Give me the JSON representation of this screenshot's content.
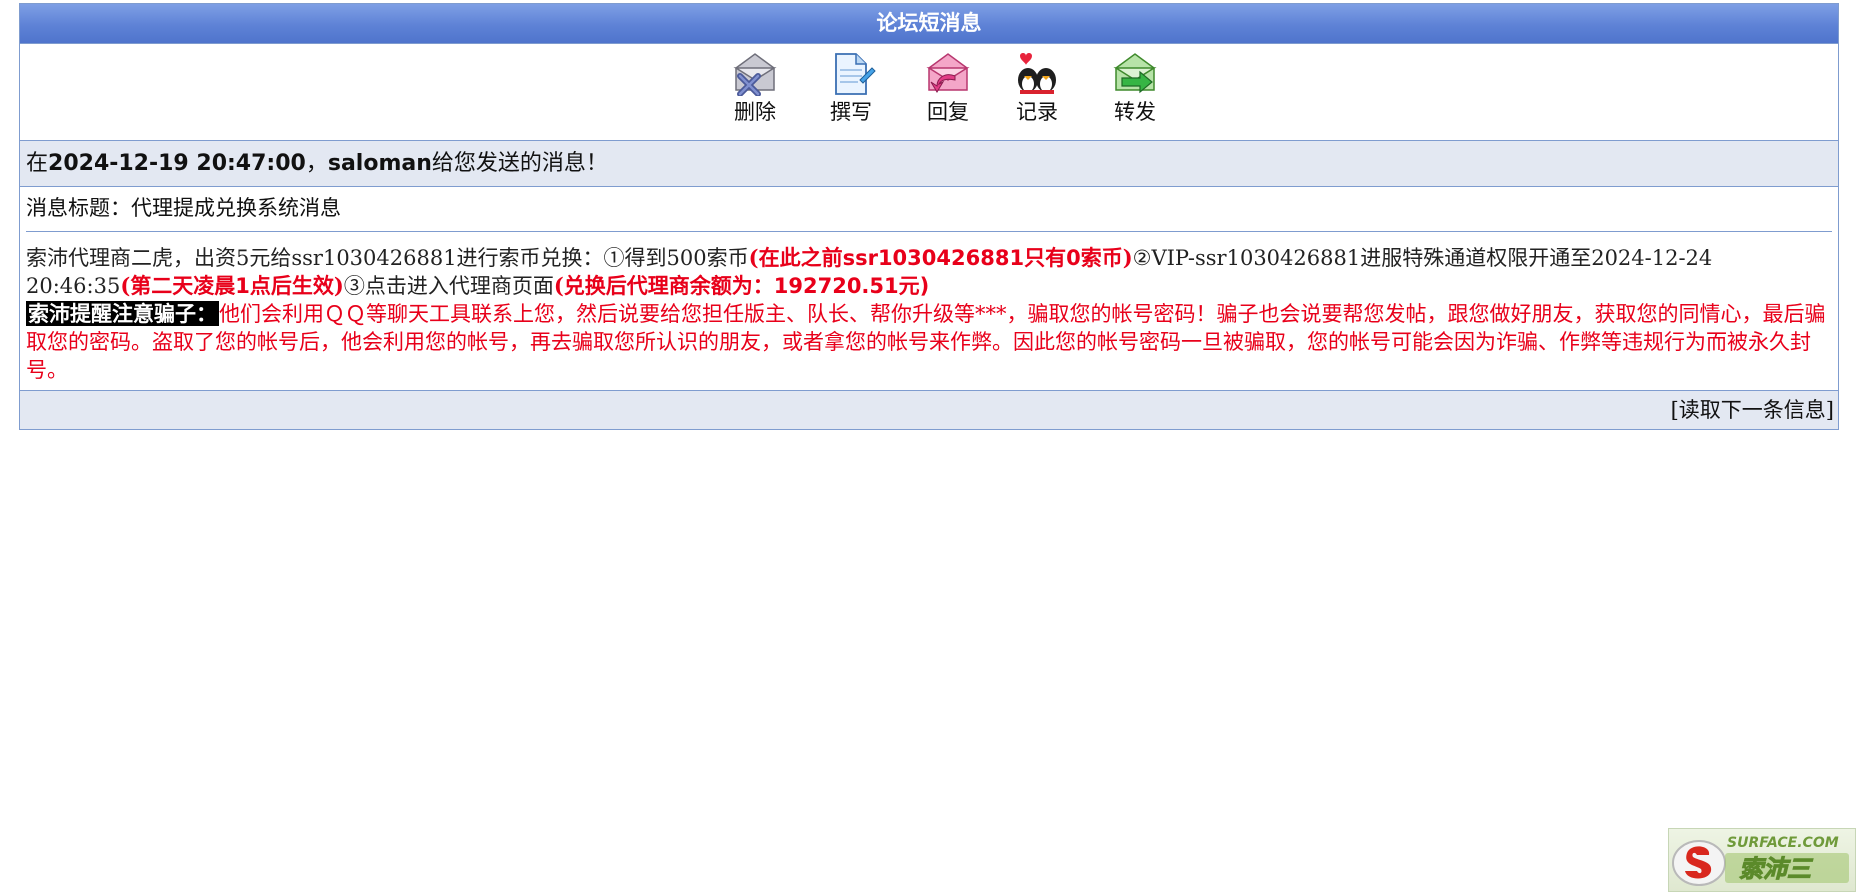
{
  "title": "论坛短消息",
  "toolbar": {
    "delete_label": "删除",
    "compose_label": "撰写",
    "reply_label": "回复",
    "record_label": "记录",
    "forward_label": "转发"
  },
  "sender": {
    "prefix": "在",
    "datetime": "2024-12-19 20:47:00",
    "separator": "，",
    "name": "saloman",
    "suffix": "给您发送的消息！"
  },
  "subject": {
    "label": "消息标题：",
    "value": "代理提成兑换系统消息"
  },
  "body": {
    "p1": "索沛代理商二虎，出资5元给ssr1030426881进行索币兑换：①得到500索币",
    "r1_open": "(在此之前",
    "r1_user": "ssr1030426881",
    "r1_mid": "只有",
    "r1_num": "0",
    "r1_close": "索币)",
    "p2": "②VIP-ssr1030426881进服特殊通道权限开通至2024-12-24 20:46:35",
    "r2_open": "(第二天凌晨",
    "r2_num": "1",
    "r2_close": "点后生效)",
    "p3": "③点击进入代理商页面",
    "r3_open": "(兑换后代理商余额为：",
    "r3_num": "192720.51",
    "r3_unit": "元",
    "r3_close": ")"
  },
  "warning": {
    "label": "索沛提醒注意骗子：",
    "text": "他们会利用ＱＱ等聊天工具联系上您，然后说要给您担任版主、队长、帮你升级等***，骗取您的帐号密码！骗子也会说要帮您发帖，跟您做好朋友，获取您的同情心，最后骗取您的密码。盗取了您的帐号后，他会利用您的帐号，再去骗取您所认识的朋友，或者拿您的帐号来作弊。因此您的帐号密码一旦被骗取，您的帐号可能会因为诈骗、作弊等违规行为而被永久封号。"
  },
  "next": {
    "open": "[",
    "label": "读取下一条信息",
    "close": "]"
  },
  "watermark": {
    "text": "SURFACE.COM",
    "cn": "索沛三"
  },
  "colors": {
    "title_bar": "#5e82d6",
    "row_bg": "#e3e8f2",
    "border": "#7f9ccf",
    "warning_red": "#e8001a"
  }
}
